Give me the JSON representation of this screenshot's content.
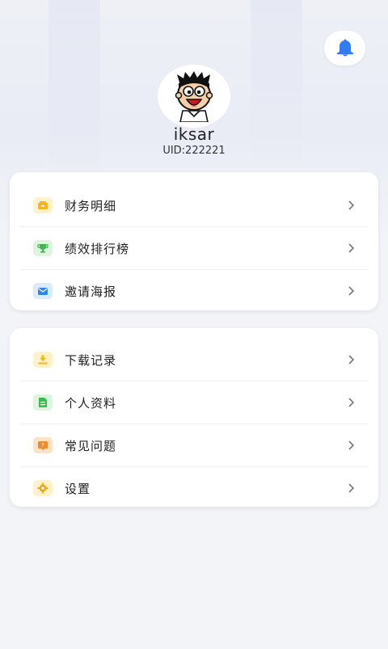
{
  "profile": {
    "username": "iksar",
    "uid": "UID:222221"
  },
  "header": {
    "bell_icon": "bell-icon",
    "bell_color": "#2f7cf6"
  },
  "menu_group_1": [
    {
      "label": "财务明细",
      "icon": "wallet-icon",
      "color": "#f5b51b",
      "bg": "#fff3cf"
    },
    {
      "label": "绩效排行榜",
      "icon": "trophy-icon",
      "color": "#3db94e",
      "bg": "#ddf4df"
    },
    {
      "label": "邀请海报",
      "icon": "mail-icon",
      "color": "#2f86e6",
      "bg": "#dcecfb"
    }
  ],
  "menu_group_2": [
    {
      "label": "下载记录",
      "icon": "download-icon",
      "color": "#f2b51d",
      "bg": "#fff2c6"
    },
    {
      "label": "个人资料",
      "icon": "document-icon",
      "color": "#3db94e",
      "bg": "#def4df"
    },
    {
      "label": "常见问题",
      "icon": "question-icon",
      "color": "#f08a2a",
      "bg": "#ffe2c6"
    },
    {
      "label": "设置",
      "icon": "gear-icon",
      "color": "#e9a815",
      "bg": "#fff1c8"
    }
  ]
}
